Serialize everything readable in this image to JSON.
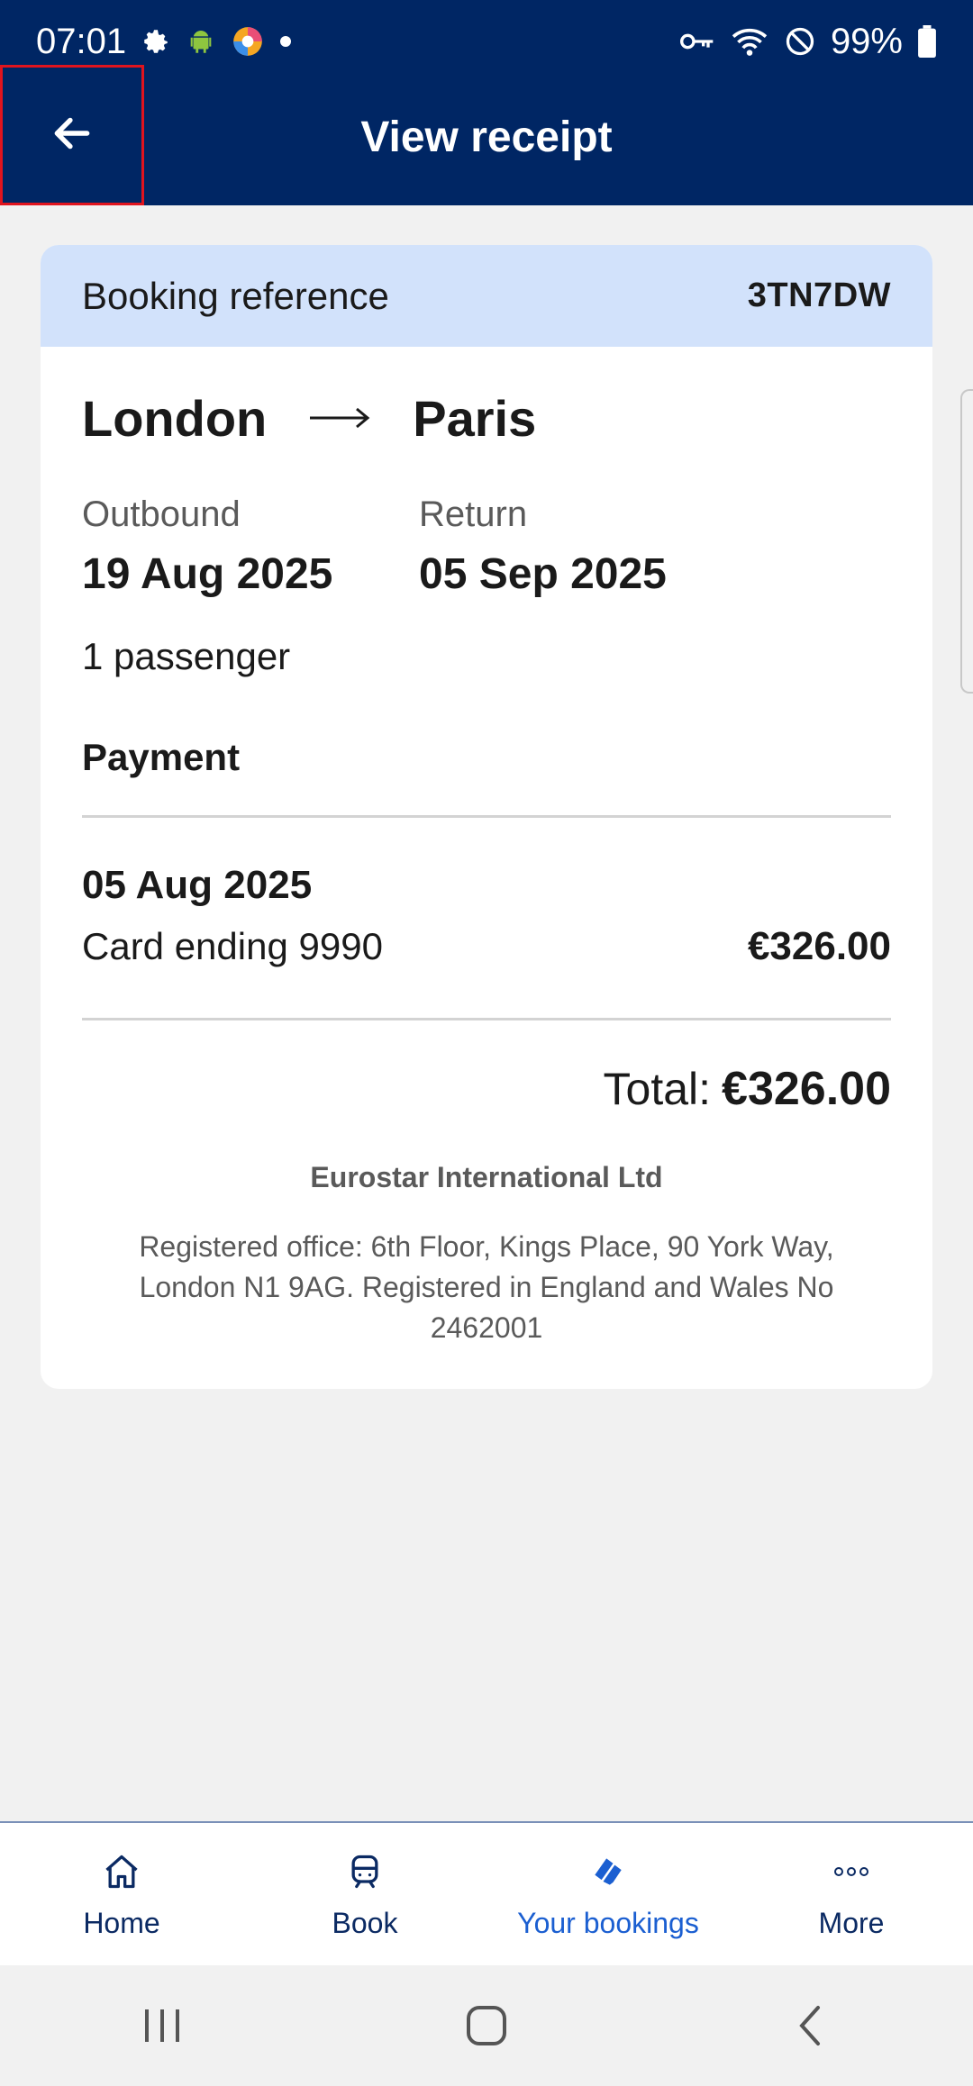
{
  "status_bar": {
    "time": "07:01",
    "battery": "99%",
    "icons": [
      "settings-icon",
      "android-icon",
      "edge-icon",
      "dot-icon",
      "key-icon",
      "wifi-icon",
      "no-disturb-icon",
      "battery-icon"
    ]
  },
  "header": {
    "title": "View receipt",
    "back_icon": "arrow-left-icon"
  },
  "booking": {
    "reference_label": "Booking reference",
    "reference_value": "3TN7DW",
    "origin": "London",
    "destination": "Paris",
    "outbound_label": "Outbound",
    "outbound_date": "19 Aug 2025",
    "return_label": "Return",
    "return_date": "05 Sep 2025",
    "passengers": "1 passenger"
  },
  "payment": {
    "title": "Payment",
    "date": "05 Aug 2025",
    "card": "Card ending 9990",
    "amount": "€326.00",
    "total_label": "Total:",
    "total_value": "€326.00"
  },
  "company": {
    "name": "Eurostar International Ltd",
    "address": "Registered office: 6th Floor, Kings Place, 90 York Way, London N1 9AG. Registered in England and Wales No 2462001"
  },
  "bottom_nav": {
    "items": [
      {
        "label": "Home",
        "icon": "home-icon"
      },
      {
        "label": "Book",
        "icon": "train-icon"
      },
      {
        "label": "Your bookings",
        "icon": "tickets-icon",
        "active": true
      },
      {
        "label": "More",
        "icon": "more-icon"
      }
    ]
  },
  "colors": {
    "header_bg": "#002664",
    "booking_bar_bg": "#d2e2fb",
    "active_nav": "#1b5fd1",
    "highlight_border": "#e0141e"
  }
}
